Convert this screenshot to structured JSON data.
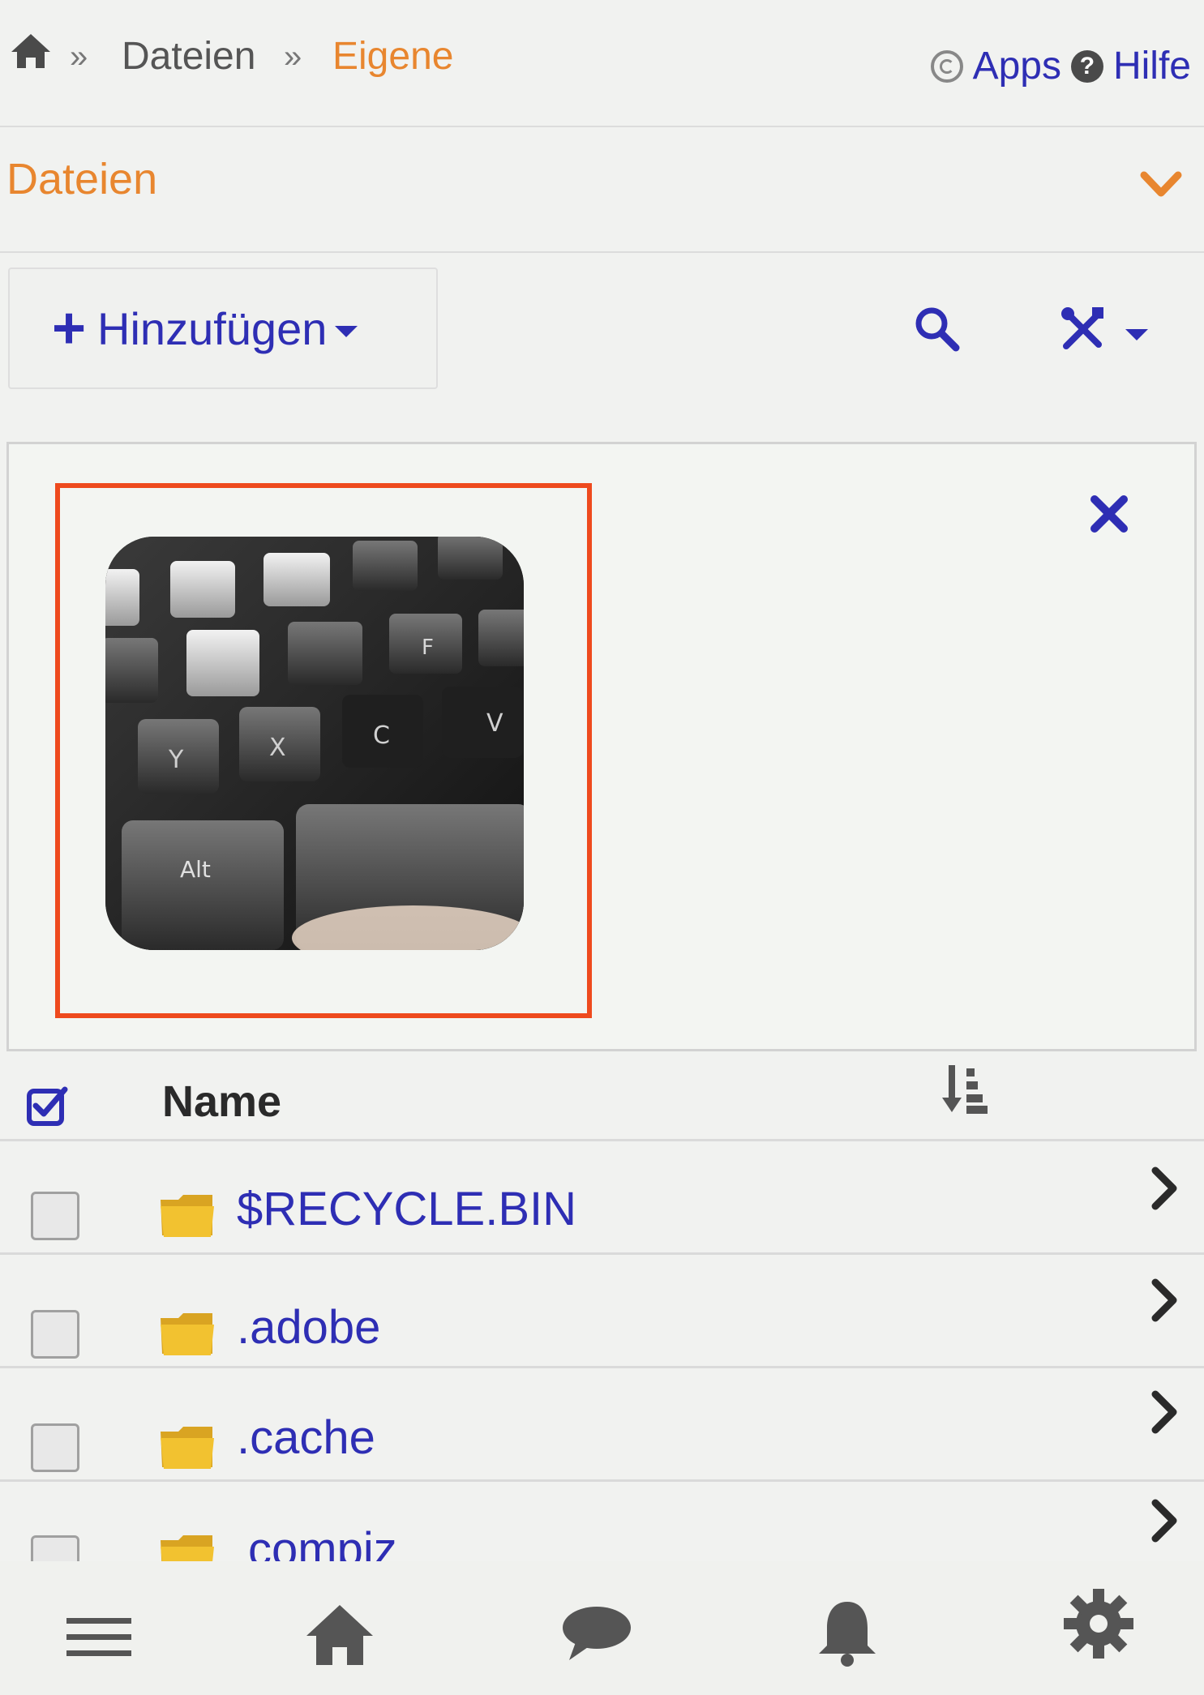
{
  "breadcrumb": {
    "sep": "»",
    "crumb1": "Dateien",
    "crumb2": "Eigene"
  },
  "topnav": {
    "apps": "Apps",
    "help": "Hilfe",
    "help_glyph": "?"
  },
  "section": {
    "title": "Dateien"
  },
  "toolbar": {
    "add_label": "Hinzufügen",
    "add_glyph": "+"
  },
  "table": {
    "column_name": "Name",
    "rows": [
      {
        "name": "$RECYCLE.BIN"
      },
      {
        "name": ".adobe"
      },
      {
        "name": ".cache"
      },
      {
        "name": "compiz"
      }
    ]
  },
  "preview": {
    "keys": [
      "Y",
      "X",
      "C",
      "V",
      "F",
      "Alt"
    ]
  },
  "colors": {
    "accent": "#e8862f",
    "link": "#2e2eb4",
    "highlight": "#ee4a1e",
    "folder": "#f2c230"
  },
  "icons": [
    "home-icon",
    "apps-icon",
    "help-icon",
    "chevron-down-icon",
    "plus-icon",
    "search-icon",
    "tools-icon",
    "close-icon",
    "select-all-icon",
    "sort-icon",
    "folder-icon",
    "chevron-right-icon",
    "menu-icon",
    "chat-icon",
    "bell-icon",
    "gear-icon"
  ]
}
